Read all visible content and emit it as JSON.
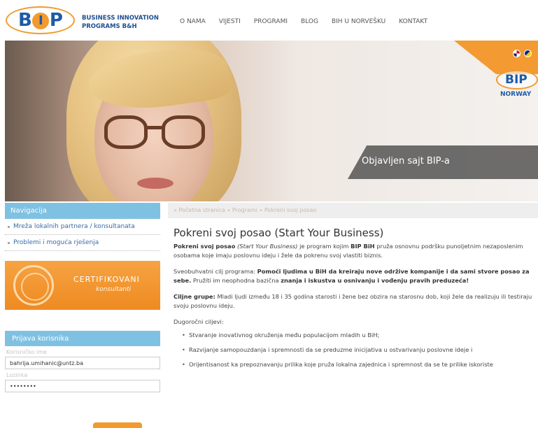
{
  "header": {
    "logo_text": "BIP",
    "brand_line1": "BUSINESS INNOVATION",
    "brand_line2": "PROGRAMS B&H",
    "nav": [
      "O NAMA",
      "VIJESTI",
      "PROGRAMI",
      "BLOG",
      "BIH U NORVEŠKU",
      "KONTAKT"
    ]
  },
  "hero": {
    "banner_text": "Objavljen sajt BIP-a",
    "norway_logo": "BIP",
    "norway_label": "NORWAY",
    "flags": [
      "uk-flag-icon",
      "bih-flag-icon"
    ]
  },
  "sidebar": {
    "nav_title": "Navigacija",
    "items": [
      "Mreža lokalnih partnera / konsultanata",
      "Problemi i moguća rješenja"
    ],
    "cert_line1": "CERTIFIKOVANI",
    "cert_line2": "konsultanti",
    "login_title": "Prijava korisnika",
    "username_label": "Korisničko ime",
    "username_value": "bahrija.umihanic@untz.ba",
    "password_label": "Lozinka",
    "password_value": "••••••••"
  },
  "breadcrumb": [
    "» Početna stranica",
    "» Programi",
    "» Pokreni svoj posao"
  ],
  "content": {
    "title": "Pokreni svoj posao (Start Your Business)",
    "p1_b1": "Pokreni svoj posao",
    "p1_i1": "(Start Your Business)",
    "p1_t1": " je program kojim ",
    "p1_b2": "BIP BiH",
    "p1_t2": " pruža osnovnu podršku punoljetnim nezaposlenim osobama koje imaju poslovnu ideju i žele da pokrenu svoj vlastiti biznis.",
    "p2_t1": "Sveobuhvatni cilj programa: ",
    "p2_b1": "Pomoći ljudima u BiH da kreiraju nove održive kompanije i da sami stvore posao za sebe.",
    "p2_t2": " Pružiti im neophodna bazična ",
    "p2_b2": "znanja i iskustva u osnivanju i vođenju pravih preduzeća!",
    "p3_b1": "Ciljne grupe:",
    "p3_t1": " Mladi ljudi između 18 i 35 godina starosti i žene bez obzira na starosnu dob, koji žele da realizuju ili testiraju svoju poslovnu ideju.",
    "p4": "Dugoročni ciljevi:",
    "goals": [
      "Stvaranje inovativnog okruženja među populacijom mladih u BiH;",
      "Razvijanje samopouzdanja i spremnosti da se preduzme inicijativa u ostvarivanju poslovne ideje i",
      "Orijentisanost ka prepoznavanju prilika koje pruža lokalna zajednica i spremnost da se te prilike iskoriste"
    ]
  }
}
